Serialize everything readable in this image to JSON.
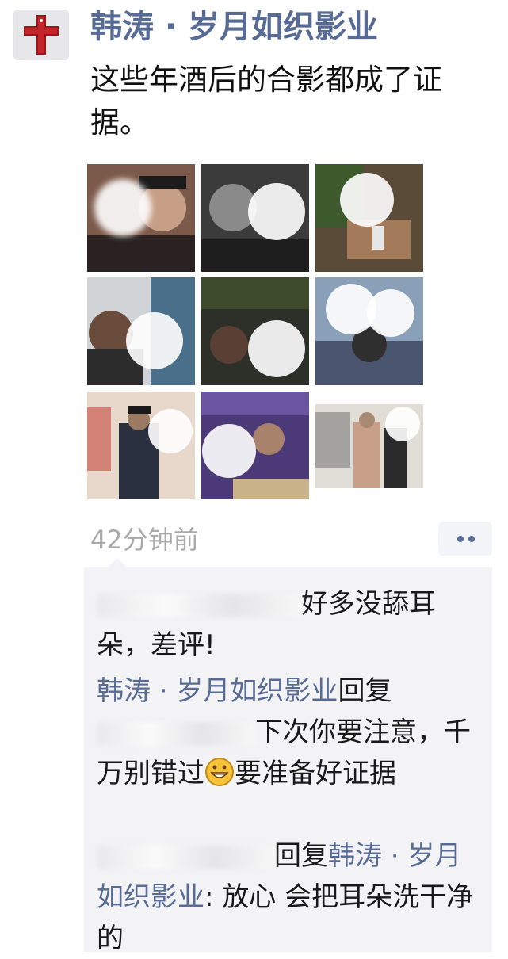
{
  "post": {
    "author": "韩涛 · 岁月如织影业",
    "text": "这些年酒后的合影都成了证据。",
    "photo_count": 9,
    "time": "42分钟前",
    "more_icon": "ellipsis-icon"
  },
  "comments": [
    {
      "text": "好多没舔耳朵，差评!"
    },
    {
      "author": "韩涛 · 岁月如织影业",
      "reply_word": "回复",
      "text_before_emoji": "下次你要注意，千万别错过",
      "text_after_emoji": "要准备好证据"
    },
    {
      "reply_word": "回复",
      "reply_to": "韩涛 · 岁月如织影业",
      "text": ": 放心 会把耳朵洗干净的"
    }
  ],
  "colors": {
    "link": "#576b95",
    "time": "#a9a9a9",
    "comment_bg": "#f3f3f5",
    "text": "#111111"
  },
  "icons": {
    "avatar": "red-cross-avatar-icon",
    "emoji": "grinning-face-emoji-icon"
  }
}
